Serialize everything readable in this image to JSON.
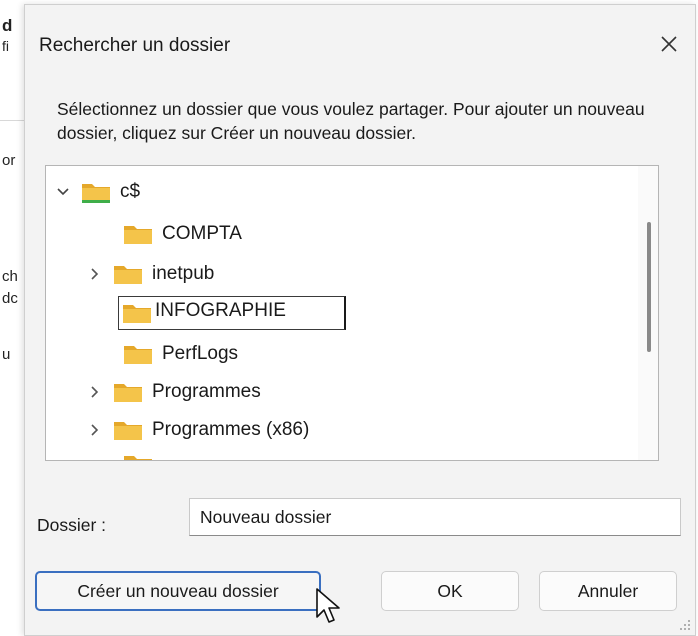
{
  "background_window": {
    "fragments": [
      "d",
      "fi",
      "or",
      "ch",
      "dc",
      "u"
    ]
  },
  "dialog": {
    "title": "Rechercher un dossier",
    "close_icon": "close-icon",
    "instruction": "Sélectionnez un dossier que vous voulez partager. Pour ajouter un nouveau dossier, cliquez sur Créer un nouveau dossier.",
    "tree": {
      "root": {
        "label": "c$",
        "expanded": true,
        "icon": "drive-folder-icon"
      },
      "items": [
        {
          "label": "COMPTA",
          "has_children": false
        },
        {
          "label": "inetpub",
          "has_children": true
        },
        {
          "label": "INFOGRAPHIE",
          "has_children": false,
          "editing": true
        },
        {
          "label": "PerfLogs",
          "has_children": false
        },
        {
          "label": "Programmes",
          "has_children": true
        },
        {
          "label": "Programmes (x86)",
          "has_children": true
        }
      ]
    },
    "folder_field": {
      "label": "Dossier :",
      "value": "Nouveau dossier"
    },
    "buttons": {
      "create": "Créer un nouveau dossier",
      "ok": "OK",
      "cancel": "Annuler"
    },
    "colors": {
      "folder": "#f4c44a",
      "folder_dark": "#e5a82a",
      "drive_green": "#3fae49",
      "focus_blue": "#3a6fc0"
    }
  }
}
